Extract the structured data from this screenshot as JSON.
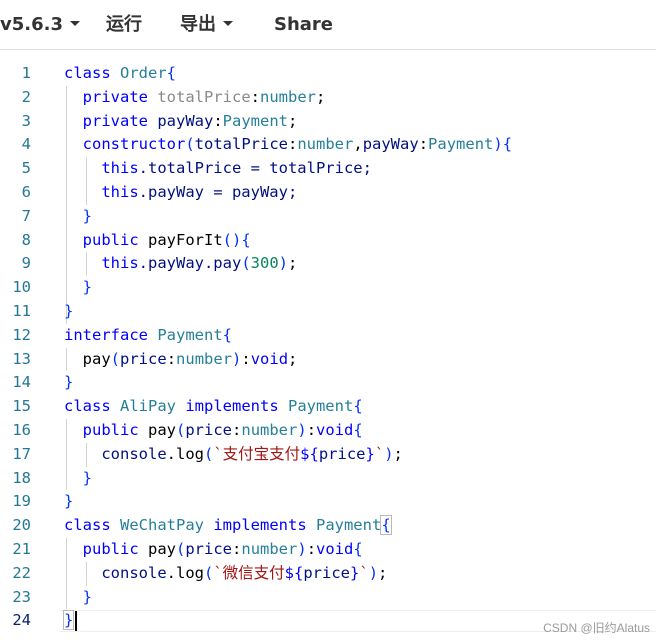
{
  "toolbar": {
    "version": "v5.6.3",
    "run": "运行",
    "export": "导出",
    "share": "Share"
  },
  "editor": {
    "line_numbers": [
      "1",
      "2",
      "3",
      "4",
      "5",
      "6",
      "7",
      "8",
      "9",
      "10",
      "11",
      "12",
      "13",
      "14",
      "15",
      "16",
      "17",
      "18",
      "19",
      "20",
      "21",
      "22",
      "23",
      "24"
    ],
    "active_line": "24",
    "lines": [
      [
        [
          "class ",
          "kw"
        ],
        [
          "Order",
          "ty"
        ],
        [
          "{",
          "br"
        ]
      ],
      [
        [
          "  ",
          ""
        ],
        [
          "private ",
          "kw"
        ],
        [
          "totalPrice",
          "dim"
        ],
        [
          ":",
          "pu"
        ],
        [
          "number",
          "ty"
        ],
        [
          ";",
          "pu"
        ]
      ],
      [
        [
          "  ",
          ""
        ],
        [
          "private ",
          "kw"
        ],
        [
          "payWay",
          "id"
        ],
        [
          ":",
          "pu"
        ],
        [
          "Payment",
          "ty"
        ],
        [
          ";",
          "pu"
        ]
      ],
      [
        [
          "  ",
          ""
        ],
        [
          "constructor",
          "kw"
        ],
        [
          "(",
          "br"
        ],
        [
          "totalPrice",
          "id"
        ],
        [
          ":",
          "pu"
        ],
        [
          "number",
          "ty"
        ],
        [
          ",",
          "pu"
        ],
        [
          "payWay",
          "id"
        ],
        [
          ":",
          "pu"
        ],
        [
          "Payment",
          "ty"
        ],
        [
          ")",
          "br"
        ],
        [
          "{",
          "br"
        ]
      ],
      [
        [
          "    ",
          ""
        ],
        [
          "this",
          "kw"
        ],
        [
          ".totalPrice = totalPrice;",
          "id"
        ]
      ],
      [
        [
          "    ",
          ""
        ],
        [
          "this",
          "kw"
        ],
        [
          ".payWay = payWay;",
          "id"
        ]
      ],
      [
        [
          "  ",
          ""
        ],
        [
          "}",
          "br"
        ]
      ],
      [
        [
          "  ",
          ""
        ],
        [
          "public ",
          "kw"
        ],
        [
          "payForIt",
          "fn"
        ],
        [
          "()",
          "br"
        ],
        [
          "{",
          "br"
        ]
      ],
      [
        [
          "    ",
          ""
        ],
        [
          "this",
          "kw"
        ],
        [
          ".payWay.pay",
          "id"
        ],
        [
          "(",
          "br"
        ],
        [
          "300",
          "num"
        ],
        [
          ")",
          "br"
        ],
        [
          ";",
          "pu"
        ]
      ],
      [
        [
          "  ",
          ""
        ],
        [
          "}",
          "br"
        ]
      ],
      [
        [
          "}",
          "br"
        ]
      ],
      [
        [
          "interface ",
          "kw"
        ],
        [
          "Payment",
          "ty"
        ],
        [
          "{",
          "br"
        ]
      ],
      [
        [
          "  ",
          ""
        ],
        [
          "pay",
          "fn"
        ],
        [
          "(",
          "br"
        ],
        [
          "price",
          "id"
        ],
        [
          ":",
          "pu"
        ],
        [
          "number",
          "ty"
        ],
        [
          ")",
          "br"
        ],
        [
          ":",
          "pu"
        ],
        [
          "void",
          "kw"
        ],
        [
          ";",
          "pu"
        ]
      ],
      [
        [
          "}",
          "br"
        ]
      ],
      [
        [
          "class ",
          "kw"
        ],
        [
          "AliPay ",
          "ty"
        ],
        [
          "implements ",
          "kw"
        ],
        [
          "Payment",
          "ty"
        ],
        [
          "{",
          "br"
        ]
      ],
      [
        [
          "  ",
          ""
        ],
        [
          "public ",
          "kw"
        ],
        [
          "pay",
          "fn"
        ],
        [
          "(",
          "br"
        ],
        [
          "price",
          "id"
        ],
        [
          ":",
          "pu"
        ],
        [
          "number",
          "ty"
        ],
        [
          ")",
          "br"
        ],
        [
          ":",
          "pu"
        ],
        [
          "void",
          "kw"
        ],
        [
          "{",
          "br"
        ]
      ],
      [
        [
          "    ",
          ""
        ],
        [
          "console",
          "id"
        ],
        [
          ".log",
          "fn"
        ],
        [
          "(",
          "br"
        ],
        [
          "`支付宝支付",
          "str"
        ],
        [
          "${",
          "tpl"
        ],
        [
          "price",
          "id"
        ],
        [
          "}",
          "tpl"
        ],
        [
          "`",
          "str"
        ],
        [
          ")",
          "br"
        ],
        [
          ";",
          "pu"
        ]
      ],
      [
        [
          "  ",
          ""
        ],
        [
          "}",
          "br"
        ]
      ],
      [
        [
          "}",
          "br"
        ]
      ],
      [
        [
          "class ",
          "kw"
        ],
        [
          "WeChatPay ",
          "ty"
        ],
        [
          "implements ",
          "kw"
        ],
        [
          "Payment",
          "ty"
        ],
        [
          "{",
          "br"
        ]
      ],
      [
        [
          "  ",
          ""
        ],
        [
          "public ",
          "kw"
        ],
        [
          "pay",
          "fn"
        ],
        [
          "(",
          "br"
        ],
        [
          "price",
          "id"
        ],
        [
          ":",
          "pu"
        ],
        [
          "number",
          "ty"
        ],
        [
          ")",
          "br"
        ],
        [
          ":",
          "pu"
        ],
        [
          "void",
          "kw"
        ],
        [
          "{",
          "br"
        ]
      ],
      [
        [
          "    ",
          ""
        ],
        [
          "console",
          "id"
        ],
        [
          ".log",
          "fn"
        ],
        [
          "(",
          "br"
        ],
        [
          "`微信支付",
          "str"
        ],
        [
          "${",
          "tpl"
        ],
        [
          "price",
          "id"
        ],
        [
          "}",
          "tpl"
        ],
        [
          "`",
          "str"
        ],
        [
          ")",
          "br"
        ],
        [
          ";",
          "pu"
        ]
      ],
      [
        [
          "  ",
          ""
        ],
        [
          "}",
          "br"
        ]
      ],
      [
        [
          "}",
          "br"
        ]
      ]
    ]
  },
  "watermark": "CSDN @旧约Alatus",
  "colors": {
    "keyword": "#0000ff",
    "type": "#267f99",
    "identifier": "#001080",
    "number": "#098658",
    "string": "#a31515",
    "bracket": "#0431fa",
    "line_number": "#237893"
  }
}
